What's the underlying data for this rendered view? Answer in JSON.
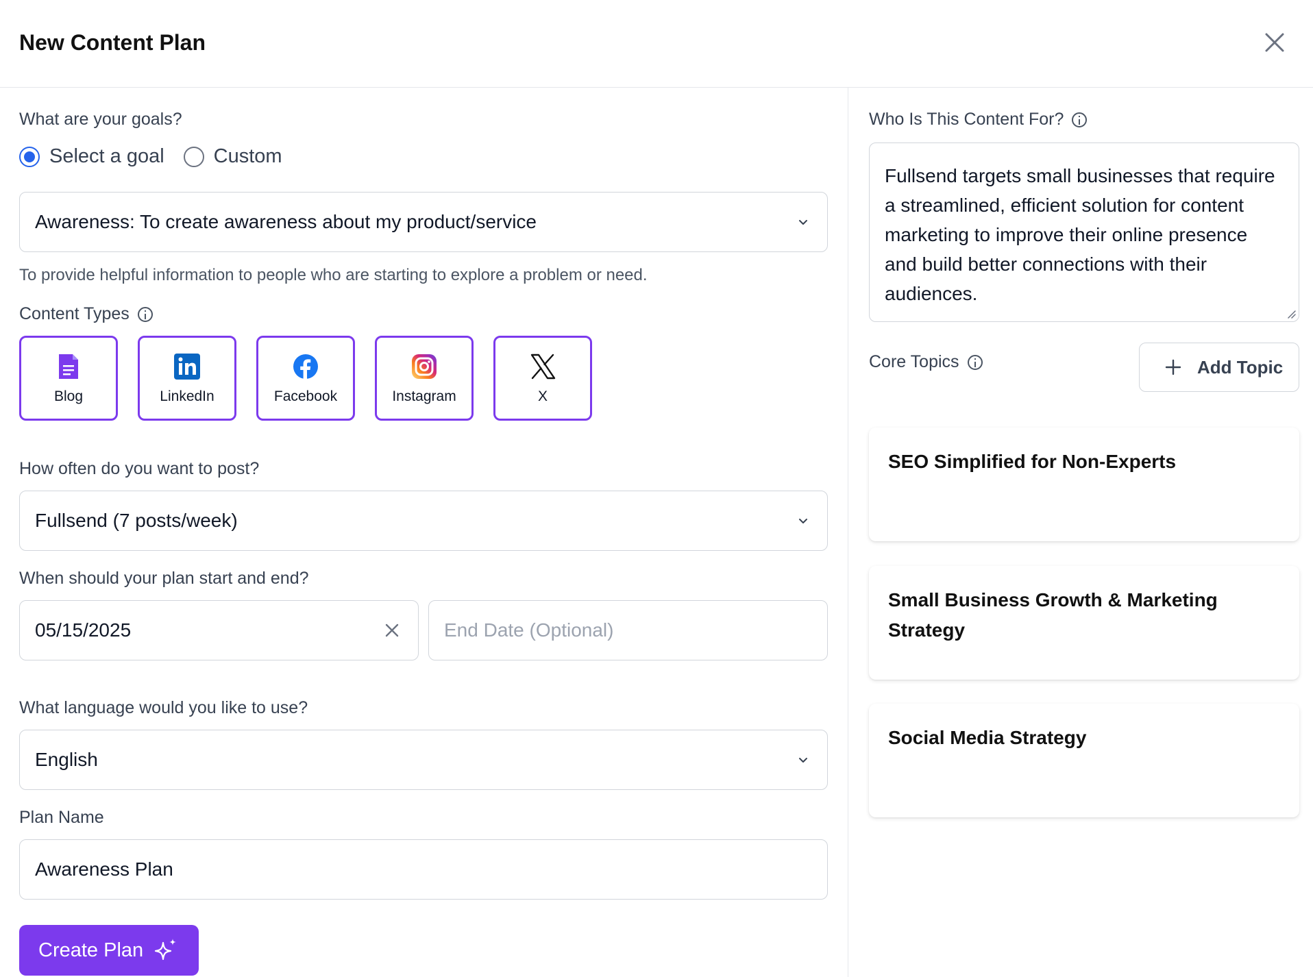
{
  "header": {
    "title": "New Content Plan"
  },
  "goals": {
    "label": "What are your goals?",
    "options": [
      "Select a goal",
      "Custom"
    ],
    "selected_option": "Select a goal",
    "selected_goal": "Awareness: To create awareness about my product/service",
    "description": "To provide helpful information to people who are starting to explore a problem or need."
  },
  "content_types": {
    "label": "Content Types",
    "items": [
      {
        "label": "Blog",
        "icon": "blog-doc-icon",
        "selected": true
      },
      {
        "label": "LinkedIn",
        "icon": "linkedin-icon",
        "selected": true
      },
      {
        "label": "Facebook",
        "icon": "facebook-icon",
        "selected": true
      },
      {
        "label": "Instagram",
        "icon": "instagram-icon",
        "selected": true
      },
      {
        "label": "X",
        "icon": "x-icon",
        "selected": true
      }
    ]
  },
  "frequency": {
    "label": "How often do you want to post?",
    "value": "Fullsend (7 posts/week)"
  },
  "dates": {
    "label": "When should your plan start and end?",
    "start_value": "05/15/2025",
    "end_placeholder": "End Date (Optional)"
  },
  "language": {
    "label": "What language would you like to use?",
    "value": "English"
  },
  "plan_name": {
    "label": "Plan Name",
    "value": "Awareness Plan"
  },
  "create_button": {
    "label": "Create Plan"
  },
  "audience": {
    "label": "Who Is This Content For?",
    "text": "Fullsend targets small businesses that require a streamlined, efficient solution for content marketing to improve their online presence and build better connections with their audiences."
  },
  "core_topics": {
    "label": "Core Topics",
    "add_label": "Add Topic",
    "items": [
      "SEO Simplified for Non-Experts",
      "Small Business Growth & Marketing Strategy",
      "Social Media Strategy"
    ]
  },
  "colors": {
    "accent": "#7c3aed",
    "radio": "#2563eb",
    "border": "#d1d5db"
  }
}
